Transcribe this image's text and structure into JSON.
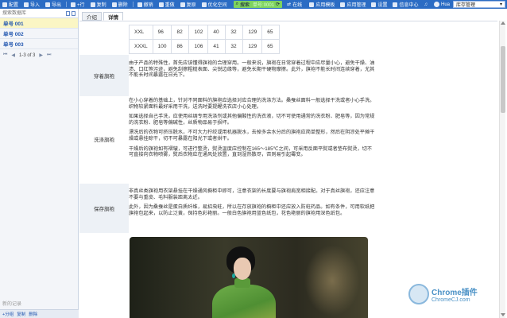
{
  "toolbar": {
    "items": [
      "配置",
      "导入",
      "导出",
      "+行",
      "复制",
      "删除",
      "撤销",
      "重做",
      "复原",
      "优化空间"
    ],
    "search_label": "搜索",
    "single_badge": "单号:0001",
    "online_label": "在线",
    "app_templates": "应用模板",
    "app_manage": "应用管理",
    "settings": "设置",
    "messages": "信息中心",
    "user": "Hua",
    "warehouse": "库存管理"
  },
  "sidebar": {
    "search_placeholder": "搜索数据库",
    "items": [
      "单号 001",
      "单号 002",
      "单号 003"
    ],
    "pager": "1-3 of 3",
    "new_label": "新的记录",
    "bottom": [
      "+分组",
      "复制",
      "删除"
    ]
  },
  "tabs": [
    "介绍",
    "详情"
  ],
  "size_table": [
    [
      "XXL",
      "96",
      "82",
      "102",
      "40",
      "32",
      "129",
      "65"
    ],
    [
      "XXXL",
      "100",
      "86",
      "106",
      "41",
      "32",
      "129",
      "65"
    ]
  ],
  "sections": {
    "wear": {
      "label": "穿着旗袍",
      "text": "由于产品的特殊性，首先应该懂得旗袍的合理穿用。一般来说，旗袍在日常穿着过程中应尽量小心，避免干燥、油渍、口红等污迹，避免刮擦粗糙表面、尖锐边缘等，避免长期干硬物摩擦。此外，旗袍不能长时间连续穿着，尤其不能长时间暴露在日光下。"
    },
    "wash": {
      "label": "洗涤旗袍",
      "paragraphs": [
        "在小心穿着的基础上，针对不同面料的旗袍应选择对应合理的洗涤方法。桑蚕丝面料一般选择干洗或者小心手洗。织物较紧面料最好采用干洗，送洗时要提醒洗衣店小心处理。",
        "如果选择自己手洗，应使用丝绸专用洗涤剂或其他偏酸性的洗衣液，切不可使用通常的洗衣粉、肥皂等，因为常规的洗衣粉、肥皂等偏碱性，丝质物品易于损坏。",
        "漂洗后的衣物可挤压脱水，不可大力拧绞或用机器脱水，去掉多余水分后的旗袍应简单整形，然后在阴凉处平摊干燥或悬挂晾干，切不可暴露在阳光下或者烘干。",
        "干燥后的旗袍如有褶皱，可进行整烫，熨烫温度应控制在165～185℃之间，可采用反面平熨或者垫布熨烫，切不可直接向衣物喷雾，熨后衣物应在通风处放置，直到湿热散尽，否则易引起霉变。"
      ]
    },
    "store": {
      "label": "保存旗袍",
      "paragraphs": [
        "非真丝类旗袍用衣架悬挂在干燥通风橱柜中即可，注意衣架的长度要与旗袍肩宽相接配。对于真丝旗袍，还应注意不要与重皮、毛料服装距离太近。",
        "此外，因为桑蚕丝是蛋白质纤维，易招虫蛀，所以在存放旗袍的橱柜中还应放入防蛀药品。如有条件，可用软纸把旗袍包起来，以防止泛黄，保持色彩艳丽。一般白色旗袍用蓝色纸包，花色艳丽的旗袍用深色纸包。"
      ]
    }
  },
  "watermark": {
    "title": "Chrome插件",
    "url": "ChromeCJ.com"
  }
}
